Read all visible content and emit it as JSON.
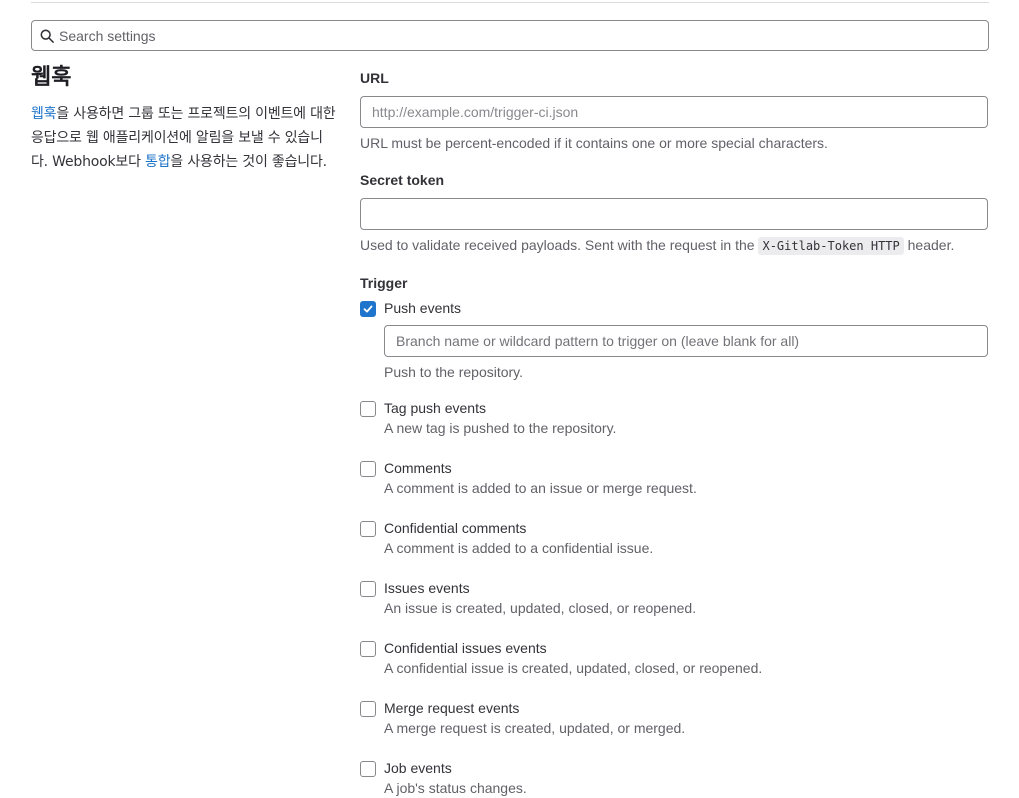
{
  "search": {
    "placeholder": "Search settings"
  },
  "section": {
    "title": "웹훅",
    "desc_link1": "웹훅",
    "desc_part1": "을 사용하면 그룹 또는 프로젝트의 이벤트에 대한 응답으로 웹 애플리케이션에 알림을 보낼 수 있습니다. Webhook보다 ",
    "desc_link2": "통합",
    "desc_part2": "을 사용하는 것이 좋습니다."
  },
  "url": {
    "label": "URL",
    "placeholder": "http://example.com/trigger-ci.json",
    "help": "URL must be percent-encoded if it contains one or more special characters."
  },
  "secret": {
    "label": "Secret token",
    "value": "",
    "help_before": "Used to validate received payloads. Sent with the request in the ",
    "help_code": "X-Gitlab-Token HTTP",
    "help_after": " header."
  },
  "trigger": {
    "label": "Trigger",
    "push": {
      "label": "Push events",
      "checked": true,
      "branch_placeholder": "Branch name or wildcard pattern to trigger on (leave blank for all)",
      "desc": "Push to the repository."
    },
    "items": [
      {
        "label": "Tag push events",
        "desc": "A new tag is pushed to the repository."
      },
      {
        "label": "Comments",
        "desc": "A comment is added to an issue or merge request."
      },
      {
        "label": "Confidential comments",
        "desc": "A comment is added to a confidential issue."
      },
      {
        "label": "Issues events",
        "desc": "An issue is created, updated, closed, or reopened."
      },
      {
        "label": "Confidential issues events",
        "desc": "A confidential issue is created, updated, closed, or reopened."
      },
      {
        "label": "Merge request events",
        "desc": "A merge request is created, updated, or merged."
      },
      {
        "label": "Job events",
        "desc": "A job's status changes."
      }
    ]
  },
  "colors": {
    "link": "#1f75cb",
    "checkbox_checked": "#1f75cb"
  }
}
